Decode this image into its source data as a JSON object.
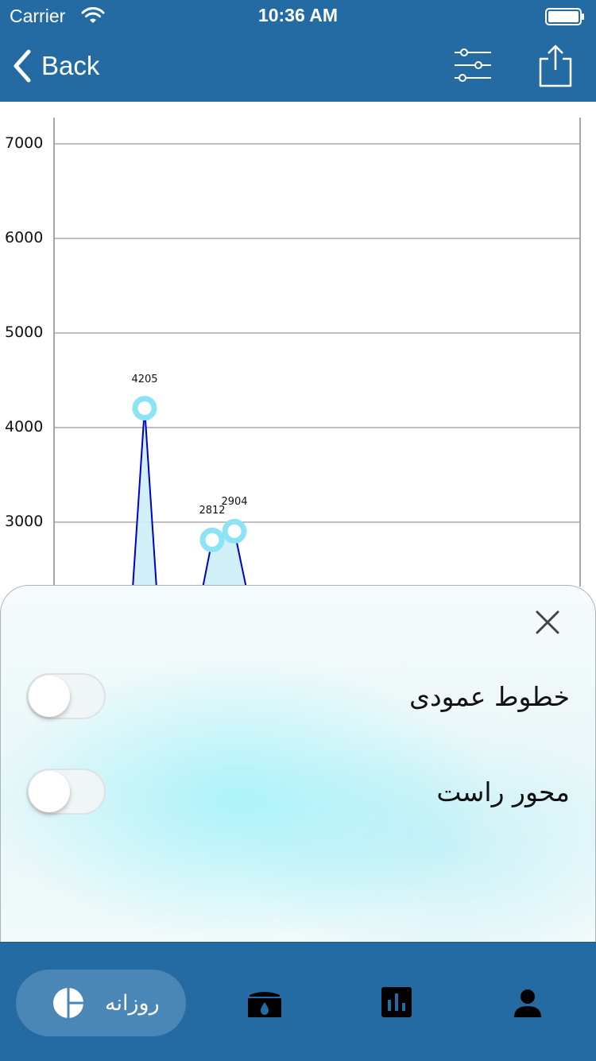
{
  "status_bar": {
    "carrier": "Carrier",
    "time": "10:36 AM"
  },
  "nav": {
    "back_label": "Back",
    "icons": [
      "chevron-left-icon",
      "sliders-icon",
      "share-icon"
    ]
  },
  "chart_data": {
    "type": "area",
    "y_ticks": [
      "7000",
      "6000",
      "5000",
      "4000",
      "3000"
    ],
    "ylim": [
      2000,
      7300
    ],
    "grid": true,
    "line_color": "#0000cc",
    "fill_color": "#cdeef7",
    "marker_color": "#8be4f5",
    "visible_points": [
      {
        "label": "4205",
        "value": 4205
      },
      {
        "label": "2812",
        "value": 2812
      },
      {
        "label": "2904",
        "value": 2904
      }
    ]
  },
  "settings_panel": {
    "rows": [
      {
        "label": "خطوط عمودی",
        "enabled": false
      },
      {
        "label": "محور راست",
        "enabled": false
      }
    ]
  },
  "tabbar": {
    "active_tab_label": "روزانه",
    "tabs": [
      "pie-chart-icon",
      "water-tank-icon",
      "bar-chart-icon",
      "user-icon"
    ],
    "accent": "#246ba3"
  }
}
